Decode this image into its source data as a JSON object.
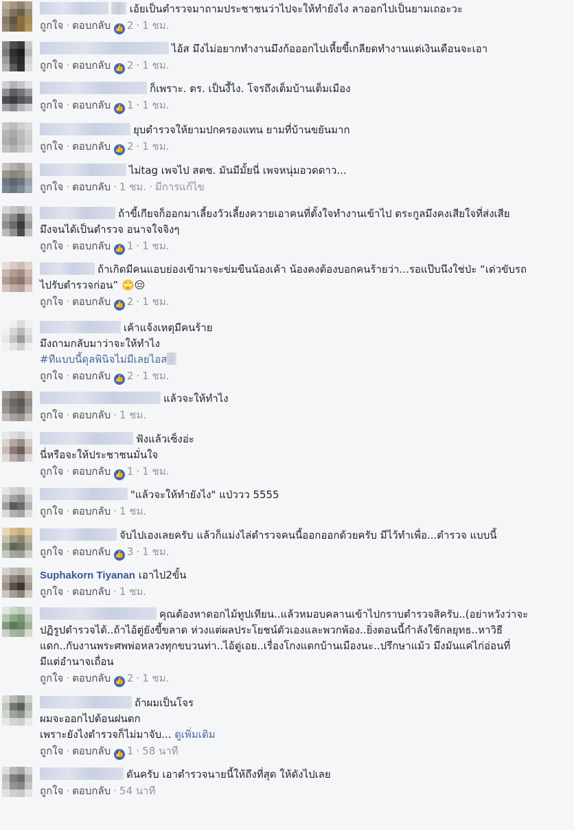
{
  "labels": {
    "like": "ถูกใจ",
    "reply": "ตอบกลับ",
    "dot": "·",
    "like_icon": "👍"
  },
  "comments": [
    {
      "lines": [
        "เอ้ยเป็นตำรวจมาถามประชาชนว่าไปจะให้ทำยังไง ลาออกไปเป็นยามเถอะวะ"
      ],
      "likes": "2",
      "time": "1 ชม."
    },
    {
      "lines": [
        "ไอ้ส มึงไม่อยากทำงานมึงก้อออกไปเหี้ยขี้เกลียดทำงานแต่เงินเดือนจะเอา"
      ],
      "likes": "2",
      "time": "1 ชม."
    },
    {
      "lines": [
        "ก็เพราะ. ตร. เป็นงี้ไง. โจรถึงเต็มบ้านเต็มเมือง"
      ],
      "likes": "1",
      "time": "1 ชม."
    },
    {
      "lines": [
        "ยุบตำรวจให้ยามปกครองแทน ยามที่บ้านขยันมาก"
      ],
      "likes": "2",
      "time": "1 ชม."
    },
    {
      "lines": [
        "ไม่tag เพจไป สตช. มันมีมั้ยนี่ เพจหนุ่มอวดดาว..."
      ],
      "time": "1 ชม.",
      "edited": "มีการแก้ไข"
    },
    {
      "lines": [
        "ถ้าขี้เกียจก็ออกมาเลี้ยงวัวเลี้ยงควายเอาคนที่ตั้งใจทำงานเข้าไป ตระกูลมึงคงเสียใจที่ส่งเสีย",
        "มึงจนได้เป็นตำรวจ อนาจใจจิงๆ"
      ],
      "likes": "1",
      "time": "1 ชม."
    },
    {
      "lines": [
        "ถ้าเกิดมีคนแอบย่องเข้ามาจะข่มขืนน้องเค้า น้องคงต้องบอกคนร้ายว่า...รอแป๊บนึงใช่ป่ะ “เด่วขับรถ",
        "ไปรับตำรวจก่อน” 🙄😔"
      ],
      "likes": "2",
      "time": "1 ชม."
    },
    {
      "lines": [
        "เค้าแจ้งเหตุมีคนร้าย",
        "มึงถามกลับมาว่าจะให้ทำไง",
        "#ทีแบบนี้ดุลพินิจไม่มีเลยไอส"
      ],
      "likes": "2",
      "time": "1 ชม."
    },
    {
      "lines": [
        "แล้วจะให้ทำไง"
      ],
      "time": "1 ชม."
    },
    {
      "lines": [
        "ฟังแล้วเซ็งอ่ะ",
        "นี่หรือจะให้ประชาชนมั่นใจ"
      ],
      "likes": "1",
      "time": "1 ชม."
    },
    {
      "lines": [
        "\"แล้วจะให้ทำยังไง\" แป่ววว 5555"
      ],
      "time": "1 ชม."
    },
    {
      "lines": [
        "จับไปเองเลยครับ แล้วก็แม่งไล่ตำรวจคนนี้ออกออกด้วยครับ มีไว้ทำเพื่อ...ตำรวจ แบบนี้"
      ],
      "likes": "3",
      "time": "1 ชม."
    },
    {
      "name": "Suphakorn Tiyanan",
      "lines": [
        "เอาไป2ขั้น"
      ],
      "time": "1 ชม."
    },
    {
      "lines": [
        "คุณต้องหาดอกไม้ทูปเทียน..แล้วหมอบคลานเข้าไปกราบตำรวจสิครับ..(อย่าหวังว่าจะ",
        "ปฏิรูปตำรวจได้..ถ้าไอ้ตู่ยังขี้ขลาด ห่วงแต่ผลประโยชน์ตัวเองและพวกพ้อง..ยิ่งตอนนี้กำลังใช้กลยุทธ..หาวิธี",
        "แดก..กับงานพระศพพ่อหลวงทุกขบวนท่า..ไอ้ตู่เอย..เรื่องโกงแดกบ้านเมืองนะ..ปรึกษาแม้ว มึงมันแค่ไก่อ่อนที่",
        "มีแต่อำนาจเถื่อน"
      ],
      "likes": "2",
      "time": "1 ชม."
    },
    {
      "lines": [
        "ถ้าผมเป็นโจร",
        "ผมจะออกไปต้อนฝนตก",
        "เพราะยังไงตำรวจก็ไม่มาจับ..."
      ],
      "see_more": "ดูเพิ่มเติม",
      "likes": "1",
      "time": "58 นาที"
    },
    {
      "lines": [
        "ดันครับ เอาตำรวจนายนี้ให้ถึงที่สุด ให้ดังไปเลย"
      ],
      "time": "54 นาที"
    }
  ]
}
